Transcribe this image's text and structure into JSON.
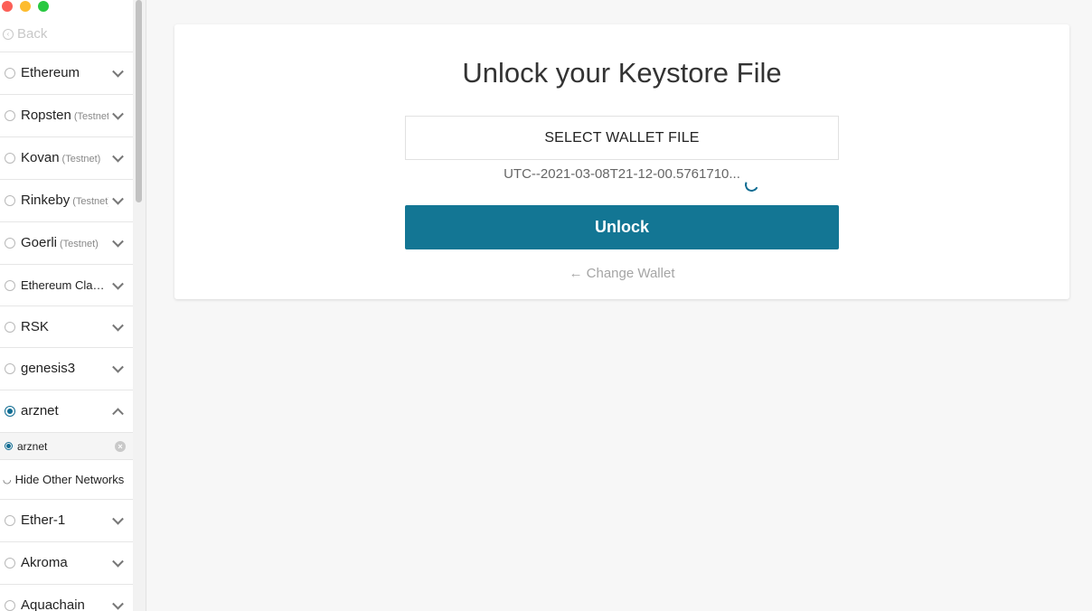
{
  "window": {
    "controls": [
      "close",
      "minimize",
      "maximize"
    ]
  },
  "sidebar": {
    "back_label": "Back",
    "networks": [
      {
        "name": "Ethereum",
        "tag": ""
      },
      {
        "name": "Ropsten",
        "tag": "(Testnet)"
      },
      {
        "name": "Kovan",
        "tag": "(Testnet)"
      },
      {
        "name": "Rinkeby",
        "tag": "(Testnet)"
      },
      {
        "name": "Goerli",
        "tag": "(Testnet)"
      },
      {
        "name": "Ethereum Classic",
        "tag": ""
      },
      {
        "name": "RSK",
        "tag": ""
      },
      {
        "name": "genesis3",
        "tag": ""
      },
      {
        "name": "arznet",
        "tag": "",
        "selected": true,
        "expanded": true
      },
      {
        "name": "Ether-1",
        "tag": ""
      },
      {
        "name": "Akroma",
        "tag": ""
      },
      {
        "name": "Aquachain",
        "tag": ""
      }
    ],
    "sub_node": {
      "name": "arznet"
    },
    "hide_other_label": "Hide Other Networks",
    "accent": "#106c92"
  },
  "main": {
    "title": "Unlock your Keystore File",
    "select_button_label": "SELECT WALLET FILE",
    "file_name": "UTC--2021-03-08T21-12-00.5761710...",
    "unlock_label": "Unlock",
    "change_wallet_label": "Change Wallet",
    "unlock_color": "#137694"
  }
}
